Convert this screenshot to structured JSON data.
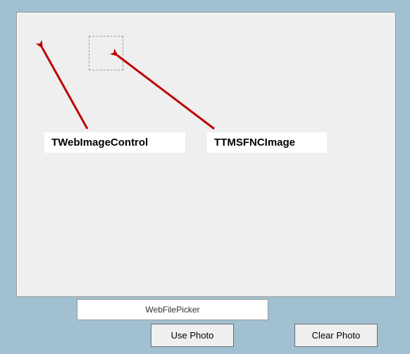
{
  "labels": {
    "webImageControl": "TWebImageControl",
    "fncImage": "TTMSFNCImage"
  },
  "filePicker": {
    "text": "WebFilePicker"
  },
  "buttons": {
    "usePhoto": "Use Photo",
    "clearPhoto": "Clear Photo"
  }
}
